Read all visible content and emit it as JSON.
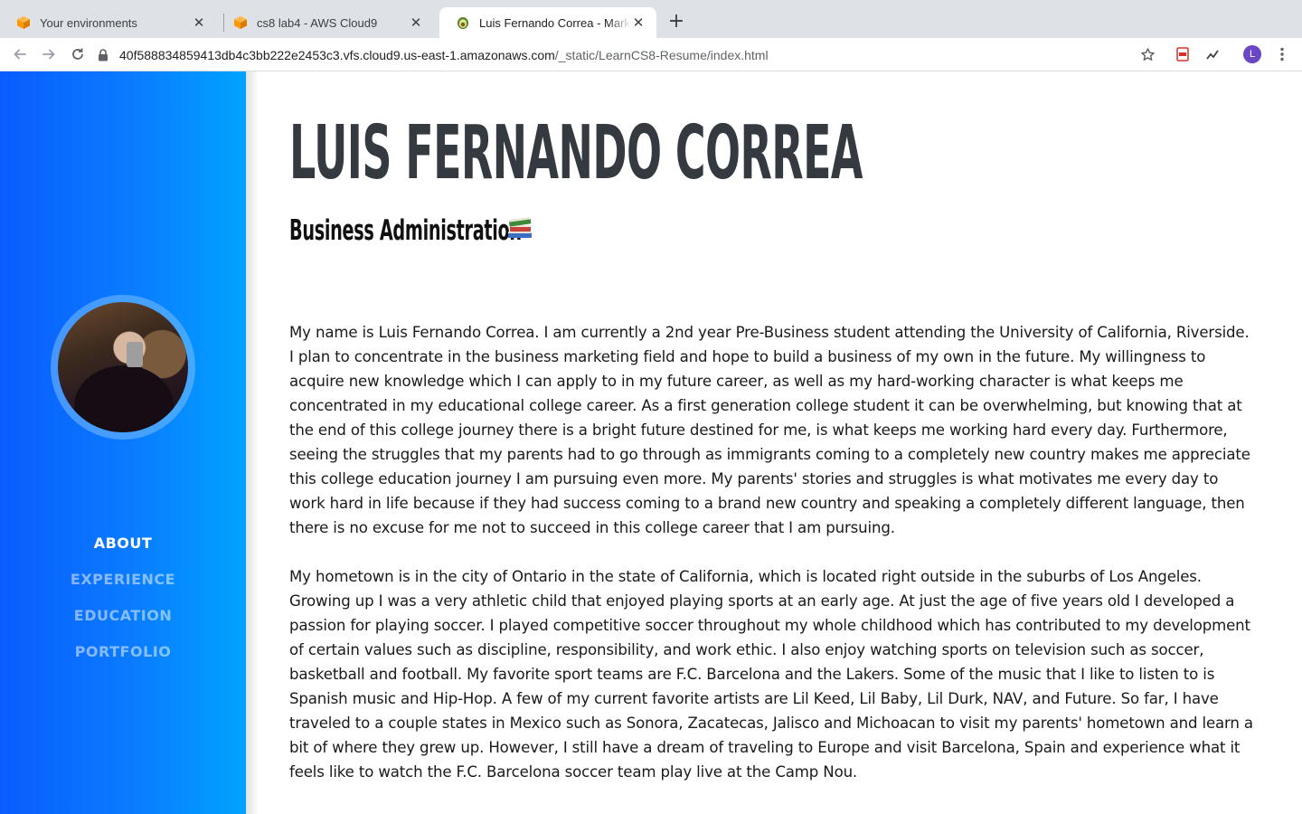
{
  "browser": {
    "tabs": [
      {
        "title": "Your environments",
        "favicon": "aws-cube-icon"
      },
      {
        "title": "cs8 lab4 - AWS Cloud9",
        "favicon": "aws-cube-icon"
      },
      {
        "title": "Luis Fernando Correa - Marketing",
        "favicon": "avocado-icon",
        "active": true
      }
    ],
    "url_host": "40f588834859413db4c3bb222e2453c3.vfs.cloud9.us-east-1.amazonaws.com",
    "url_path": "/_static/LearnCS8-Resume/index.html",
    "profile_initial": "L"
  },
  "colors": {
    "sidebar_gradient_start": "#0a5cff",
    "sidebar_gradient_end": "#00a3ff",
    "heading": "#343a40",
    "accent_tab_favicon": "#ff9900"
  },
  "sidebar": {
    "nav": [
      {
        "label": "ABOUT",
        "active": true
      },
      {
        "label": "EXPERIENCE",
        "active": false
      },
      {
        "label": "EDUCATION",
        "active": false
      },
      {
        "label": "PORTFOLIO",
        "active": false
      }
    ]
  },
  "main": {
    "name": "LUIS FERNANDO CORREA",
    "subtitle": "Business Administration",
    "subtitle_icon": "books-icon",
    "paragraphs": [
      "My name is Luis Fernando Correa. I am currently a 2nd year Pre-Business student attending the University of California, Riverside. I plan to concentrate in the business marketing field and hope to build a business of my own in the future. My willingness to acquire new knowledge which I can apply to in my future career, as well as my hard-working character is what keeps me concentrated in my educational college career. As a first generation college student it can be overwhelming, but knowing that at the end of this college journey there is a bright future destined for me, is what keeps me working hard every day. Furthermore, seeing the struggles that my parents had to go through as immigrants coming to a completely new country makes me appreciate this college education journey I am pursuing even more. My parents' stories and struggles is what motivates me every day to work hard in life because if they had success coming to a brand new country and speaking a completely different language, then there is no excuse for me not to succeed in this college career that I am pursuing.",
      "My hometown is in the city of Ontario in the state of California, which is located right outside in the suburbs of Los Angeles. Growing up I was a very athletic child that enjoyed playing sports at an early age. At just the age of five years old I developed a passion for playing soccer. I played competitive soccer throughout my whole childhood which has contributed to my development of certain values such as discipline, responsibility, and work ethic. I also enjoy watching sports on television such as soccer, basketball and football. My favorite sport teams are F.C. Barcelona and the Lakers. Some of the music that I like to listen to is Spanish music and Hip-Hop. A few of my current favorite artists are Lil Keed, Lil Baby, Lil Durk, NAV, and Future. So far, I have traveled to a couple states in Mexico such as Sonora, Zacatecas, Jalisco and Michoacan to visit my parents' hometown and learn a bit of where they grew up. However, I still have a dream of traveling to Europe and visit Barcelona, Spain and experience what it feels like to watch the F.C. Barcelona soccer team play live at the Camp Nou."
    ]
  }
}
